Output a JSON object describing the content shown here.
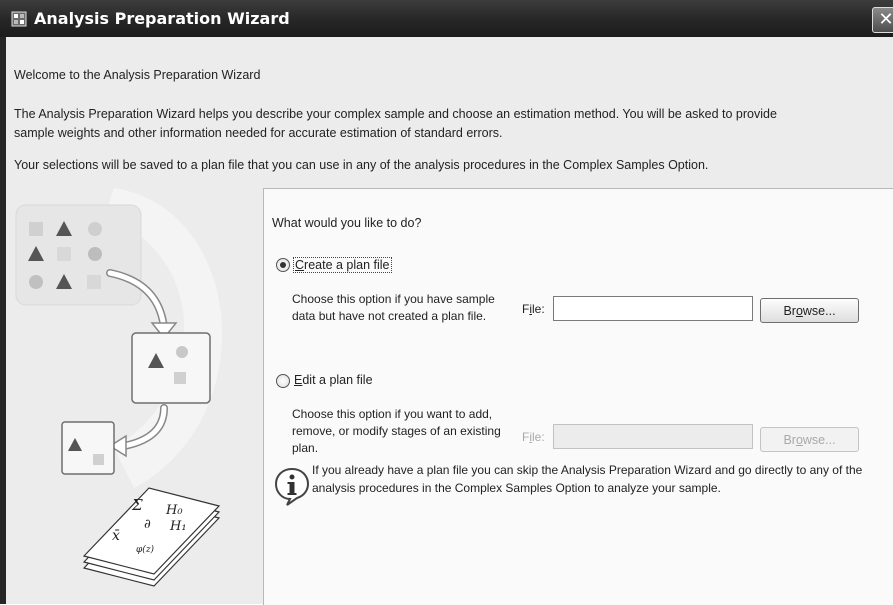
{
  "window": {
    "title": "Analysis Preparation Wizard",
    "close_glyph": "✕"
  },
  "intro": {
    "welcome": "Welcome to the Analysis Preparation Wizard",
    "desc_line1": "The Analysis Preparation Wizard helps you describe your complex sample and choose an estimation method. You will be asked to provide",
    "desc_line2": "sample weights and other information needed for accurate estimation of standard errors.",
    "save_note": "Your selections will be saved to a plan file that you can use in any of the analysis procedures in the Complex Samples Option."
  },
  "panel": {
    "question": "What would you like to do?",
    "options": [
      {
        "label_prefix": "",
        "mnemonic": "C",
        "label_rest": "reate a plan file",
        "selected": true,
        "description": "Choose this option if you have sample data but have not created a plan file.",
        "file_label_prefix": "F",
        "file_mnemonic": "i",
        "file_label_rest": "le:",
        "file_value": "",
        "browse_prefix": "Br",
        "browse_mnemonic": "o",
        "browse_rest": "wse...",
        "enabled": true
      },
      {
        "label_prefix": "",
        "mnemonic": "E",
        "label_rest": "dit a plan file",
        "selected": false,
        "description": "Choose this option if you want to add, remove, or modify stages of an existing plan.",
        "file_label_prefix": "F",
        "file_mnemonic": "i",
        "file_label_rest": "le:",
        "file_value": "",
        "browse_prefix": "Br",
        "browse_mnemonic": "o",
        "browse_rest": "wse...",
        "enabled": false
      }
    ],
    "info": "If you already have a plan file you can skip the Analysis Preparation Wizard and go directly to any of the analysis procedures in the Complex Samples Option to analyze your sample.",
    "info_icon": "info-icon"
  },
  "illustration": {
    "formula_symbols": [
      "Σ",
      "H₀",
      "∂",
      "H₁",
      "x̄",
      "φ(z)"
    ]
  },
  "colors": {
    "titlebar": "#262626",
    "content_bg": "#ececec",
    "panel_bg": "#fafafa"
  }
}
